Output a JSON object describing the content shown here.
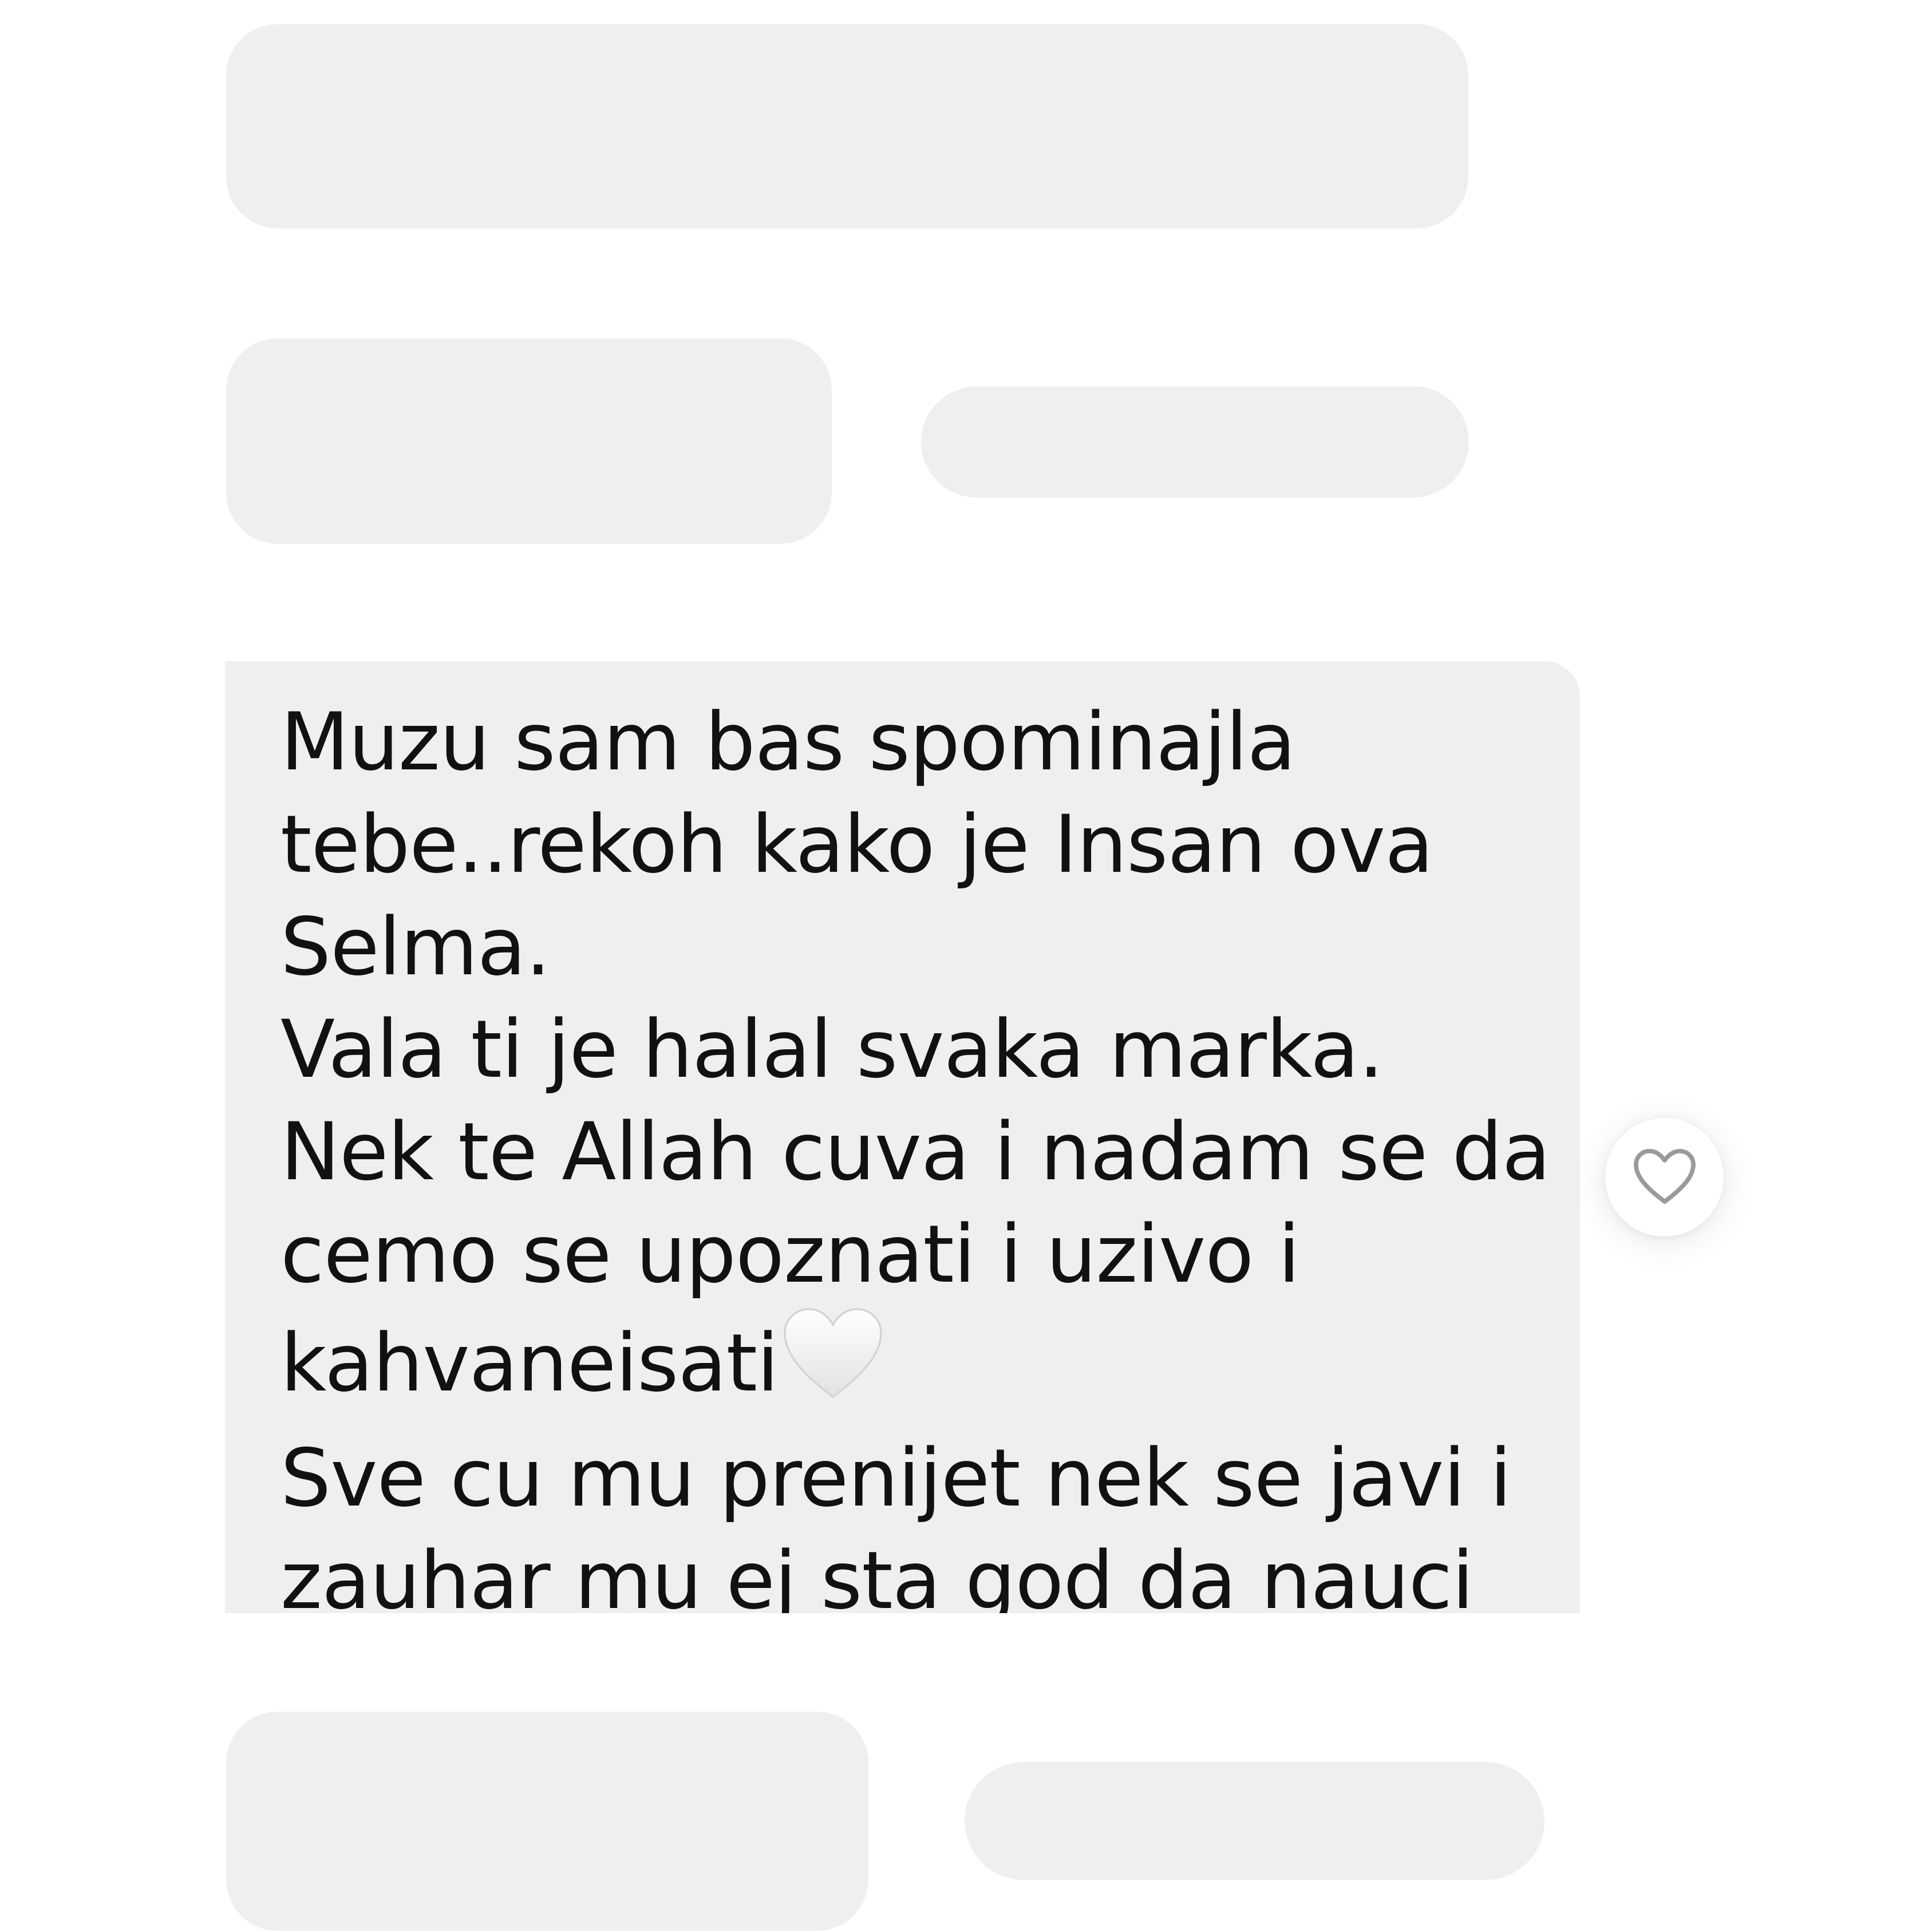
{
  "conversation": {
    "message": {
      "line1": "Muzu sam bas spominajla",
      "line2": "tebe..rekoh kako je Insan ova",
      "line3": "Selma.",
      "line4": "Vala ti je halal svaka marka.",
      "line5": "Nek te Allah cuva i nadam se da",
      "line6": "cemo se upoznati i uzivo i",
      "line7": "kahvaneisati",
      "line8": "Sve cu mu prenijet nek se javi i",
      "line9": "zauhar mu ej sta god da nauci",
      "emoji": "white-heart-icon"
    },
    "like_button": {
      "icon": "heart-outline-icon",
      "liked": false
    },
    "redacted_bubbles": 5
  },
  "colors": {
    "bubble": "#efefef",
    "text": "#111111",
    "background": "#ffffff"
  }
}
